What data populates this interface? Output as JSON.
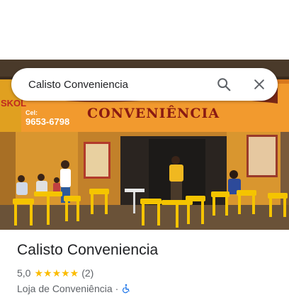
{
  "search": {
    "query": "Calisto Conveniencia"
  },
  "photo": {
    "sign_text": "CONVENIÊNCIA",
    "sign_brand_partial": "SKOL",
    "sign_phone_label": "Cel:",
    "sign_phone": "9653-6798"
  },
  "place": {
    "name": "Calisto Conveniencia",
    "rating": "5,0",
    "stars": "★★★★★",
    "review_count": "(2)",
    "category": "Loja de Conveniência",
    "separator": "·"
  },
  "icons": {
    "search": "search-icon",
    "close": "close-icon",
    "accessibility": "wheelchair-accessible-icon"
  },
  "colors": {
    "star": "#fbbc04",
    "accessibility": "#1a73e8",
    "sign_orange": "#f29a2e",
    "wall_yellow": "#e8a838",
    "chair_yellow": "#f5c400"
  }
}
